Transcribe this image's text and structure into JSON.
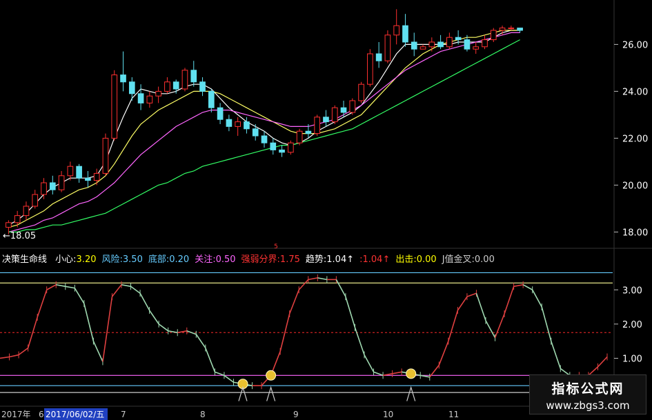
{
  "upper_axis": {
    "ticks": [
      "18.00",
      "20.00",
      "22.00",
      "24.00",
      "26.00"
    ],
    "low_label": "←18.05"
  },
  "indicator_bar": {
    "name": "决策生命线",
    "top_marker": "5",
    "items": [
      {
        "label": "小心:",
        "value": "3.20",
        "label_color": "#ffffff",
        "value_color": "#ffff00"
      },
      {
        "label": "风险:",
        "value": "3.50",
        "label_color": "#66ccff",
        "value_color": "#66ccff"
      },
      {
        "label": "底部:",
        "value": "0.20",
        "label_color": "#66ccff",
        "value_color": "#66ccff"
      },
      {
        "label": "关注:",
        "value": "0.50",
        "label_color": "#ff66ff",
        "value_color": "#ff66ff"
      },
      {
        "label": "强弱分界:",
        "value": "1.75",
        "label_color": "#ff3333",
        "value_color": "#ff3333"
      },
      {
        "label": "趋势:",
        "value": "1.04↑",
        "label_color": "#ffffff",
        "value_color": "#ffffff"
      },
      {
        "label": ":",
        "value": "1.04↑",
        "label_color": "#ff3333",
        "value_color": "#ff3333"
      },
      {
        "label": "出击:",
        "value": "0.00",
        "label_color": "#ffff00",
        "value_color": "#ffff00"
      },
      {
        "label": "J值金叉:",
        "value": "0.00",
        "label_color": "#cccccc",
        "value_color": "#cccccc"
      }
    ]
  },
  "lower_axis": {
    "ticks": [
      "1.00",
      "2.00",
      "3.00"
    ]
  },
  "time_axis": {
    "year": "2017年",
    "first_month": "6",
    "selected_date": "2017/06/02/五",
    "months": [
      "7",
      "8",
      "9",
      "10",
      "11"
    ]
  },
  "watermark": {
    "line1": "指标公式网",
    "line2": "www.zbgs3.com"
  },
  "colors": {
    "up": "#ff3030",
    "down": "#60e0f0",
    "ma5": "#ffffff",
    "ma10": "#ffff66",
    "ma20": "#ff66ff",
    "ma60": "#33ff66",
    "ma120": "#ffffcc"
  },
  "chart_data": [
    {
      "type": "candlestick",
      "ylim": [
        17.6,
        27.6
      ],
      "y_ticks": [
        18,
        20,
        22,
        24,
        26
      ],
      "ohlc": [
        [
          18.2,
          18.5,
          17.9,
          18.4
        ],
        [
          18.4,
          18.9,
          18.2,
          18.7
        ],
        [
          18.7,
          19.3,
          18.5,
          19.1
        ],
        [
          19.1,
          19.8,
          19.0,
          19.6
        ],
        [
          19.6,
          20.3,
          19.4,
          20.1
        ],
        [
          20.1,
          20.4,
          19.6,
          19.8
        ],
        [
          19.8,
          20.6,
          19.7,
          20.4
        ],
        [
          20.4,
          21.0,
          20.2,
          20.8
        ],
        [
          20.8,
          20.9,
          20.1,
          20.3
        ],
        [
          20.3,
          20.6,
          19.9,
          20.2
        ],
        [
          20.2,
          20.7,
          20.0,
          20.5
        ],
        [
          20.5,
          22.2,
          20.4,
          22.0
        ],
        [
          22.0,
          24.9,
          21.9,
          24.7
        ],
        [
          24.7,
          25.7,
          24.0,
          24.4
        ],
        [
          24.4,
          24.6,
          23.6,
          23.9
        ],
        [
          23.9,
          24.3,
          23.2,
          23.5
        ],
        [
          23.5,
          24.0,
          23.3,
          23.8
        ],
        [
          23.8,
          24.2,
          23.5,
          24.0
        ],
        [
          24.0,
          24.6,
          23.9,
          24.4
        ],
        [
          24.4,
          24.5,
          23.9,
          24.1
        ],
        [
          24.1,
          25.0,
          24.0,
          24.9
        ],
        [
          24.9,
          25.3,
          24.2,
          24.4
        ],
        [
          24.4,
          24.6,
          23.8,
          24.0
        ],
        [
          24.0,
          24.1,
          23.1,
          23.3
        ],
        [
          23.3,
          23.5,
          22.6,
          22.8
        ],
        [
          22.8,
          23.0,
          22.3,
          22.5
        ],
        [
          22.5,
          22.9,
          22.1,
          22.7
        ],
        [
          22.7,
          22.9,
          22.2,
          22.4
        ],
        [
          22.4,
          22.6,
          21.9,
          22.1
        ],
        [
          22.1,
          22.3,
          21.6,
          21.8
        ],
        [
          21.8,
          22.0,
          21.3,
          21.5
        ],
        [
          21.5,
          21.7,
          21.2,
          21.4
        ],
        [
          21.4,
          21.9,
          21.3,
          21.8
        ],
        [
          21.8,
          22.4,
          21.7,
          22.3
        ],
        [
          22.3,
          22.6,
          22.0,
          22.2
        ],
        [
          22.2,
          23.0,
          22.1,
          22.9
        ],
        [
          22.9,
          23.2,
          22.5,
          22.7
        ],
        [
          22.7,
          23.4,
          22.6,
          23.3
        ],
        [
          23.3,
          23.6,
          22.9,
          23.1
        ],
        [
          23.1,
          23.7,
          23.0,
          23.6
        ],
        [
          23.6,
          24.4,
          23.5,
          24.3
        ],
        [
          24.3,
          25.8,
          24.2,
          25.6
        ],
        [
          25.6,
          26.1,
          25.0,
          25.3
        ],
        [
          25.3,
          26.6,
          25.2,
          26.4
        ],
        [
          26.4,
          27.5,
          26.0,
          26.8
        ],
        [
          26.8,
          27.3,
          25.9,
          26.1
        ],
        [
          26.1,
          26.5,
          25.5,
          25.8
        ],
        [
          25.8,
          26.0,
          25.9,
          25.9
        ],
        [
          25.9,
          26.3,
          25.7,
          26.1
        ],
        [
          26.1,
          26.4,
          25.8,
          25.9
        ],
        [
          25.9,
          26.5,
          25.8,
          26.3
        ],
        [
          26.3,
          26.6,
          26.0,
          26.2
        ],
        [
          26.2,
          26.4,
          25.7,
          25.8
        ],
        [
          25.8,
          26.1,
          25.6,
          25.9
        ],
        [
          25.9,
          26.4,
          25.8,
          26.2
        ],
        [
          26.2,
          26.7,
          26.1,
          26.6
        ],
        [
          26.6,
          26.8,
          26.4,
          26.7
        ],
        [
          26.7,
          26.8,
          26.6,
          26.7
        ],
        [
          26.7,
          26.7,
          26.5,
          26.6
        ]
      ],
      "ma": [
        {
          "name": "MA5",
          "values": [
            18.3,
            18.5,
            18.8,
            19.2,
            19.6,
            19.9,
            20.1,
            20.3,
            20.3,
            20.3,
            20.4,
            21.0,
            22.0,
            22.9,
            23.7,
            24.1,
            24.0,
            23.9,
            23.9,
            24.0,
            24.2,
            24.3,
            24.3,
            24.1,
            23.7,
            23.3,
            23.0,
            22.7,
            22.5,
            22.3,
            22.0,
            21.8,
            21.7,
            21.8,
            22.0,
            22.3,
            22.5,
            22.7,
            22.9,
            23.1,
            23.4,
            23.9,
            24.4,
            25.0,
            25.6,
            26.0,
            26.0,
            26.0,
            26.0,
            26.0,
            26.0,
            26.1,
            26.1,
            26.1,
            26.1,
            26.3,
            26.5,
            26.6,
            26.6
          ]
        },
        {
          "name": "MA10",
          "values": [
            18.2,
            18.3,
            18.5,
            18.7,
            18.9,
            19.2,
            19.4,
            19.6,
            19.8,
            19.9,
            20.1,
            20.4,
            20.9,
            21.5,
            22.1,
            22.6,
            22.9,
            23.2,
            23.4,
            23.6,
            23.8,
            24.0,
            24.0,
            24.0,
            23.9,
            23.7,
            23.5,
            23.3,
            23.1,
            22.9,
            22.7,
            22.5,
            22.3,
            22.2,
            22.2,
            22.2,
            22.3,
            22.4,
            22.6,
            22.8,
            23.0,
            23.4,
            23.8,
            24.2,
            24.6,
            25.0,
            25.3,
            25.6,
            25.8,
            26.0,
            26.1,
            26.2,
            26.3,
            26.3,
            26.4,
            26.5,
            26.6,
            26.6,
            26.6
          ]
        },
        {
          "name": "MA20",
          "values": [
            18.0,
            18.1,
            18.2,
            18.3,
            18.5,
            18.6,
            18.8,
            19.0,
            19.2,
            19.3,
            19.5,
            19.8,
            20.1,
            20.5,
            20.9,
            21.3,
            21.6,
            21.9,
            22.2,
            22.5,
            22.7,
            22.9,
            23.1,
            23.2,
            23.2,
            23.2,
            23.1,
            23.0,
            22.9,
            22.8,
            22.7,
            22.6,
            22.5,
            22.5,
            22.5,
            22.6,
            22.7,
            22.8,
            23.0,
            23.2,
            23.4,
            23.7,
            24.0,
            24.3,
            24.6,
            24.9,
            25.1,
            25.3,
            25.5,
            25.7,
            25.8,
            25.9,
            26.0,
            26.1,
            26.2,
            26.3,
            26.4,
            26.5,
            26.5
          ]
        },
        {
          "name": "MA60",
          "values": [
            18.0,
            18.0,
            18.1,
            18.1,
            18.2,
            18.3,
            18.3,
            18.4,
            18.5,
            18.6,
            18.7,
            18.8,
            19.0,
            19.2,
            19.4,
            19.6,
            19.8,
            20.0,
            20.1,
            20.3,
            20.5,
            20.6,
            20.8,
            20.9,
            21.0,
            21.1,
            21.2,
            21.3,
            21.4,
            21.5,
            21.6,
            21.7,
            21.7,
            21.8,
            21.9,
            22.0,
            22.1,
            22.2,
            22.3,
            22.4,
            22.6,
            22.8,
            23.0,
            23.2,
            23.4,
            23.6,
            23.8,
            24.0,
            24.2,
            24.4,
            24.6,
            24.8,
            25.0,
            25.2,
            25.4,
            25.6,
            25.8,
            26.0,
            26.2
          ]
        },
        {
          "name": "MA120",
          "values": [
            null,
            null,
            null,
            null,
            null,
            null,
            null,
            null,
            null,
            null,
            null,
            null,
            null,
            null,
            null,
            null,
            null,
            null,
            null,
            null,
            null,
            null,
            null,
            null,
            null,
            null,
            null,
            null,
            null,
            null,
            null,
            null,
            null,
            null,
            null,
            null,
            null,
            null,
            null,
            null,
            null,
            null,
            null,
            null,
            null,
            null,
            null,
            null,
            null,
            null,
            null,
            null,
            null,
            null,
            null,
            null,
            null,
            null,
            null
          ]
        }
      ]
    },
    {
      "type": "line",
      "ylim": [
        -0.3,
        3.65
      ],
      "y_ticks": [
        1,
        2,
        3
      ],
      "reference_lines": [
        {
          "value": 3.5,
          "color": "#66ccff"
        },
        {
          "value": 3.2,
          "color": "#ffff99"
        },
        {
          "value": 1.75,
          "color": "#cc2222",
          "dashed": true
        },
        {
          "value": 0.5,
          "color": "#ff66ff"
        },
        {
          "value": 0.2,
          "color": "#66ccff"
        },
        {
          "value": 0.0,
          "color": "#cccccc"
        }
      ],
      "values": [
        1.0,
        1.04,
        1.1,
        1.3,
        2.2,
        3.0,
        3.15,
        3.1,
        3.05,
        2.6,
        1.5,
        0.9,
        2.8,
        3.15,
        3.1,
        2.9,
        2.4,
        2.0,
        1.8,
        1.75,
        1.8,
        1.7,
        1.3,
        0.6,
        0.5,
        0.3,
        0.25,
        0.2,
        0.2,
        0.5,
        1.2,
        2.3,
        3.0,
        3.3,
        3.35,
        3.3,
        3.3,
        2.8,
        1.9,
        1.1,
        0.6,
        0.5,
        0.55,
        0.6,
        0.55,
        0.5,
        0.45,
        0.8,
        1.5,
        2.4,
        2.8,
        2.9,
        2.1,
        1.6,
        2.3,
        3.1,
        3.15,
        3.0,
        2.5,
        1.5,
        0.7,
        0.5,
        0.5,
        0.5,
        0.75,
        1.04
      ],
      "signals": [
        {
          "index": 26,
          "label": "出击"
        },
        {
          "index": 29,
          "label": "出击"
        },
        {
          "index": 44,
          "label": "出击"
        }
      ]
    }
  ]
}
